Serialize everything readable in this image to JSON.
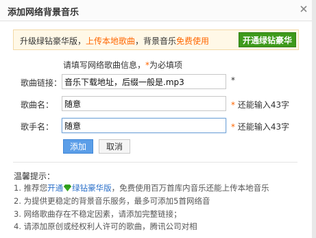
{
  "dialog": {
    "title": "添加网络背景音乐"
  },
  "banner": {
    "text_prefix": "升级绿钻豪华版，",
    "upload_link": "上传本地歌曲",
    "text_mid": "，背景音乐",
    "free_use": "免费使用",
    "cta_button": "开通绿钻豪华"
  },
  "form": {
    "hint": "请填写网络歌曲信息，",
    "required_mark": "*",
    "required_text": "为必填项",
    "fields": [
      {
        "label": "歌曲链接：",
        "value": "音乐下载地址，后缀一般是.mp3",
        "mark": "*",
        "note": ""
      },
      {
        "label": "歌曲名：",
        "value": "随意",
        "mark": "*",
        "note": "还能输入43字"
      },
      {
        "label": "歌手名：",
        "value": "随意",
        "mark": "*",
        "note": "还能输入43字"
      }
    ],
    "add_button": "添加",
    "cancel_button": "取消"
  },
  "tips": {
    "title": "温馨提示：",
    "line1_prefix": "1. 推荐您",
    "line1_link": "开通",
    "line1_link2": "绿钻豪华版",
    "line1_suffix": "，免费使用百万首库内音乐还能上传本地音乐",
    "line2": "2. 为提供更稳定的背景音乐服务，最多可添加5首网络音",
    "line3": "3. 网络歌曲存在不稳定因素，请添加完整链接；",
    "line4": "4. 请添加原创或经权利人许可的歌曲，腾讯公司对相"
  },
  "colors": {
    "accent_orange": "#ff6600",
    "link_blue": "#2a6fc9",
    "vip_green": "#3e9a1c",
    "primary_blue": "#5b9ee8"
  },
  "icons": {
    "close": "close-icon",
    "gem": "green-diamond-icon"
  }
}
